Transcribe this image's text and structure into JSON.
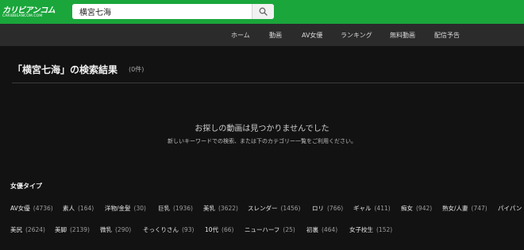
{
  "header": {
    "logo_text": "カリビアンコム",
    "logo_subtext": "CARIBBEANCOM.COM",
    "search": {
      "value": "横宮七海",
      "placeholder": ""
    },
    "colors": {
      "bar": "#1aa63b",
      "nav": "#2b2b2b",
      "background": "#121212"
    }
  },
  "nav": {
    "items": [
      {
        "label": "ホーム"
      },
      {
        "label": "動画"
      },
      {
        "label": "AV女優"
      },
      {
        "label": "ランキング"
      },
      {
        "label": "無料動画"
      },
      {
        "label": "配信予告"
      }
    ]
  },
  "results": {
    "title": "「横宮七海」の検索結果",
    "count": "(0件)",
    "not_found_title": "お探しの動画は見つかりませんでした",
    "not_found_desc": "新しいキーワードでの検索、または下のカテゴリー一覧をご利用ください。"
  },
  "categories": {
    "heading": "女優タイプ",
    "row1": [
      {
        "label": "AV女優",
        "count": "(4736)"
      },
      {
        "label": "素人",
        "count": "(164)"
      },
      {
        "label": "洋物/金髪",
        "count": "(30)"
      },
      {
        "label": "巨乳",
        "count": "(1936)"
      },
      {
        "label": "美乳",
        "count": "(3622)"
      },
      {
        "label": "スレンダー",
        "count": "(1456)"
      },
      {
        "label": "ロリ",
        "count": "(766)"
      },
      {
        "label": "ギャル",
        "count": "(411)"
      },
      {
        "label": "痴女",
        "count": "(942)"
      },
      {
        "label": "熟女/人妻",
        "count": "(747)"
      },
      {
        "label": "パイパン",
        "count": ""
      }
    ],
    "row2": [
      {
        "label": "美尻",
        "count": "(2624)"
      },
      {
        "label": "美脚",
        "count": "(2139)"
      },
      {
        "label": "微乳",
        "count": "(290)"
      },
      {
        "label": "そっくりさん",
        "count": "(93)"
      },
      {
        "label": "10代",
        "count": "(66)"
      },
      {
        "label": "ニューハーフ",
        "count": "(25)"
      },
      {
        "label": "初裏",
        "count": "(464)"
      },
      {
        "label": "女子校生",
        "count": "(152)"
      }
    ]
  }
}
